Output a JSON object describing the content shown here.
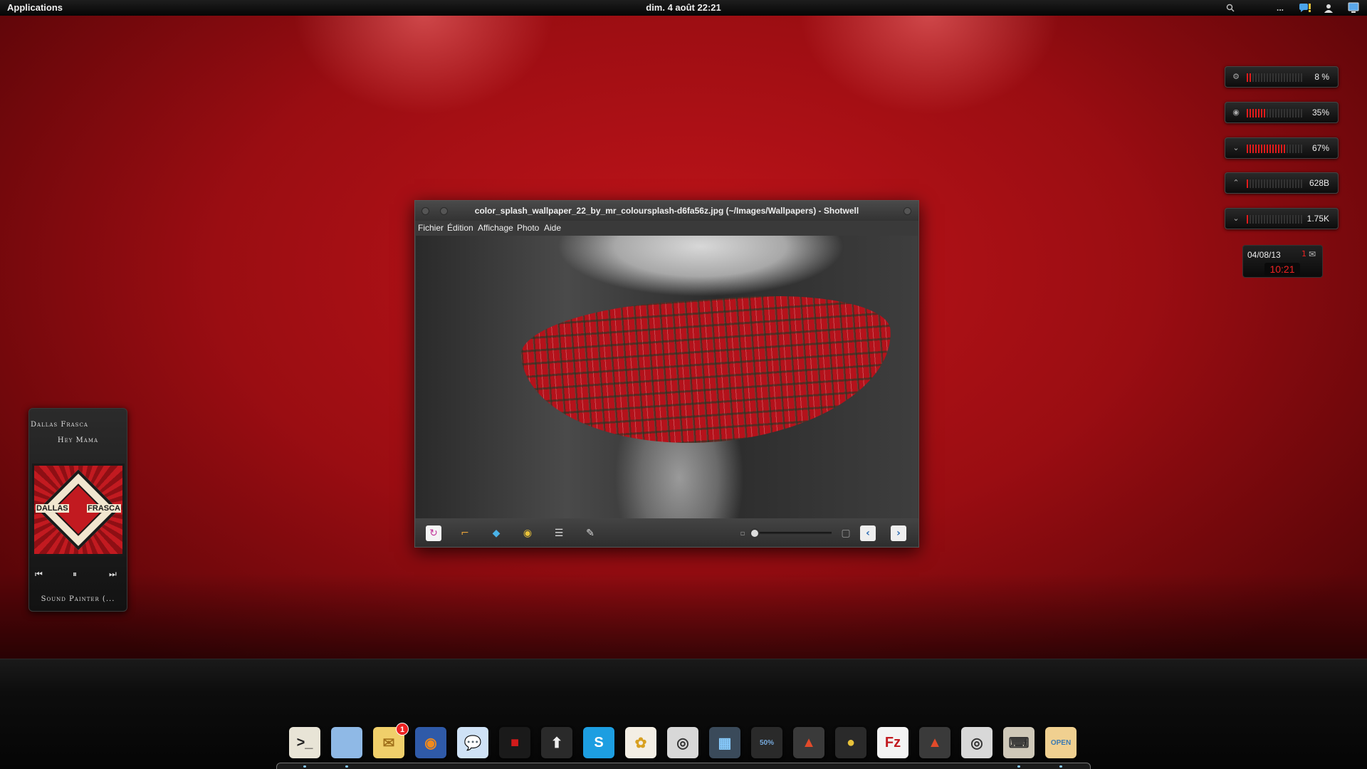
{
  "top_panel": {
    "applications_label": "Applications",
    "clock_text": "dim. 4 août 22:21",
    "tray_icons": [
      "search-icon",
      "more-icon",
      "chat-notification-icon",
      "user-icon",
      "screen-icon"
    ],
    "more_label": "..."
  },
  "system_meters": [
    {
      "icon": "cpu-icon",
      "value": "8 %",
      "level": 8
    },
    {
      "icon": "memory-icon",
      "value": "35%",
      "level": 35
    },
    {
      "icon": "disk-icon",
      "value": "67%",
      "level": 67
    },
    {
      "icon": "upload-icon",
      "value": "628B",
      "level": 3
    },
    {
      "icon": "download-icon",
      "value": "1.75K",
      "level": 3
    }
  ],
  "date_widget": {
    "date": "04/08/13",
    "mail_count": "1",
    "time": "10:21"
  },
  "music_player": {
    "artist": "Dallas Frasca",
    "track": "Hey Mama",
    "cover_text_left": "DALLAS",
    "cover_text_right": "FRASCA",
    "prev_icon": "⏮",
    "pause_icon": "⏸",
    "next_icon": "⏭",
    "next_track": "Sound Painter (..."
  },
  "shotwell": {
    "title": "color_splash_wallpaper_22_by_mr_coloursplash-d6fa56z.jpg (~/Images/Wallpapers) - Shotwell",
    "menu": [
      "Fichier",
      "Édition",
      "Affichage",
      "Photo",
      "Aide"
    ],
    "toolbar_icons": [
      "rotate-icon",
      "crop-icon",
      "straighten-icon",
      "red-eye-icon",
      "adjust-icon",
      "enhance-icon"
    ],
    "zoom_level": 0,
    "prev_label": "‹",
    "next_label": "›"
  },
  "dock": {
    "items": [
      {
        "name": "terminal",
        "glyph": ">_",
        "bg": "#e8e4d6",
        "fg": "#222"
      },
      {
        "name": "files",
        "glyph": "",
        "bg": "#8fb9e6",
        "fg": "#fff"
      },
      {
        "name": "mail",
        "glyph": "✉",
        "bg": "#f0cf6a",
        "fg": "#a0701a",
        "badge": "1"
      },
      {
        "name": "firefox",
        "glyph": "◉",
        "bg": "#2f5aa8",
        "fg": "#f08a1c"
      },
      {
        "name": "chat",
        "glyph": "💬",
        "bg": "#cfe2f6",
        "fg": "#4a7ab3"
      },
      {
        "name": "app-red",
        "glyph": "■",
        "bg": "#1a1a1a",
        "fg": "#d21b1b"
      },
      {
        "name": "update",
        "glyph": "⬆",
        "bg": "#2a2a2a",
        "fg": "#eee"
      },
      {
        "name": "skype",
        "glyph": "S",
        "bg": "#1d9ee1",
        "fg": "#fff"
      },
      {
        "name": "photos",
        "glyph": "✿",
        "bg": "#f3eee4",
        "fg": "#d8a020"
      },
      {
        "name": "camera",
        "glyph": "◎",
        "bg": "#d8d8d8",
        "fg": "#333"
      },
      {
        "name": "image-viewer",
        "glyph": "▦",
        "bg": "#3a4a5a",
        "fg": "#8cf"
      },
      {
        "name": "usage",
        "glyph": "50%",
        "bg": "#2a2a2a",
        "fg": "#7ad"
      },
      {
        "name": "stats",
        "glyph": "▲",
        "bg": "#3a3a3a",
        "fg": "#e24a2a"
      },
      {
        "name": "system",
        "glyph": "●",
        "bg": "#2a2a2a",
        "fg": "#e8c23a"
      },
      {
        "name": "filezilla",
        "glyph": "Fz",
        "bg": "#f4f4f4",
        "fg": "#c21a20"
      },
      {
        "name": "monitor",
        "glyph": "▲",
        "bg": "#3a3a3a",
        "fg": "#e24a2a"
      },
      {
        "name": "screenshot",
        "glyph": "◎",
        "bg": "#d8d8d8",
        "fg": "#333"
      },
      {
        "name": "keyboard",
        "glyph": "⌨",
        "bg": "#cfc8b8",
        "fg": "#333"
      },
      {
        "name": "store",
        "glyph": "OPEN",
        "bg": "#f0d090",
        "fg": "#3a7ab3"
      }
    ]
  }
}
